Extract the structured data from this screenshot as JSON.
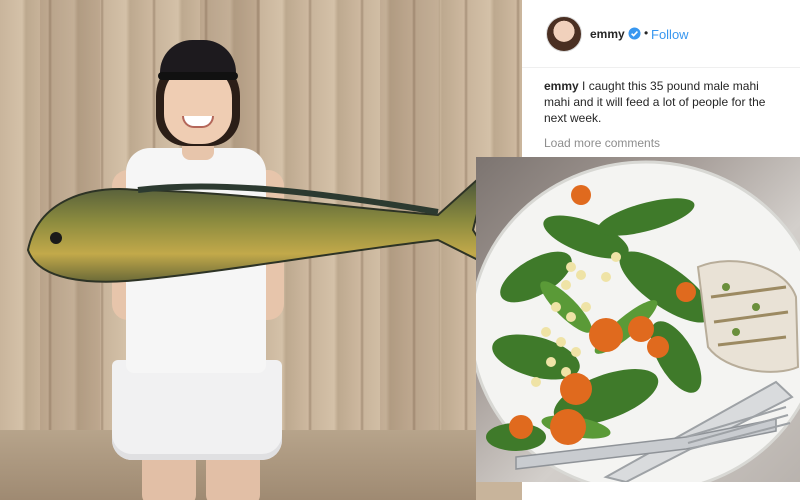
{
  "post": {
    "username": "emmy",
    "separator": "•",
    "follow_label": "Follow",
    "caption_user": "emmy",
    "caption_text": " I caught this 35 pound male mahi mahi and it will feed a lot of people for the next week.",
    "load_more_label": "Load more comments"
  },
  "colors": {
    "link": "#3897f0",
    "verified": "#3897f0",
    "text": "#262626",
    "muted": "#8e8e8e"
  },
  "icons": {
    "verified": "verified-badge-icon"
  }
}
